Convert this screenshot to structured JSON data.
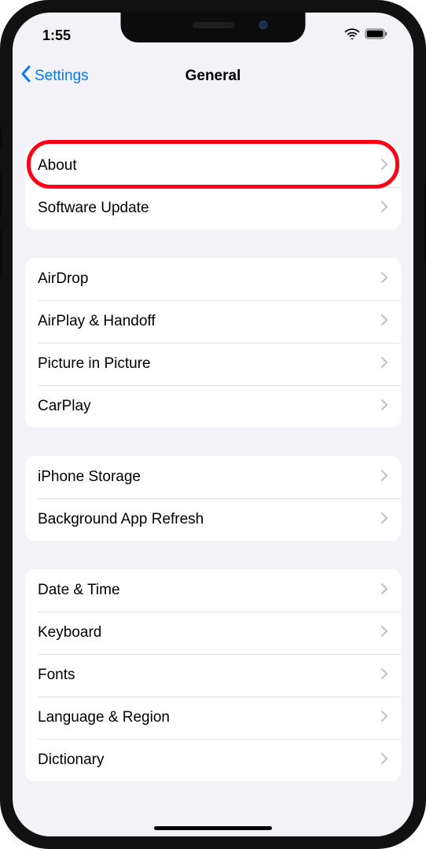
{
  "status": {
    "time": "1:55"
  },
  "nav": {
    "back_label": "Settings",
    "title": "General"
  },
  "groups": [
    {
      "rows": [
        {
          "label": "About",
          "highlight": true
        },
        {
          "label": "Software Update"
        }
      ]
    },
    {
      "rows": [
        {
          "label": "AirDrop"
        },
        {
          "label": "AirPlay & Handoff"
        },
        {
          "label": "Picture in Picture"
        },
        {
          "label": "CarPlay"
        }
      ]
    },
    {
      "rows": [
        {
          "label": "iPhone Storage"
        },
        {
          "label": "Background App Refresh"
        }
      ]
    },
    {
      "rows": [
        {
          "label": "Date & Time"
        },
        {
          "label": "Keyboard"
        },
        {
          "label": "Fonts"
        },
        {
          "label": "Language & Region"
        },
        {
          "label": "Dictionary"
        }
      ]
    }
  ]
}
